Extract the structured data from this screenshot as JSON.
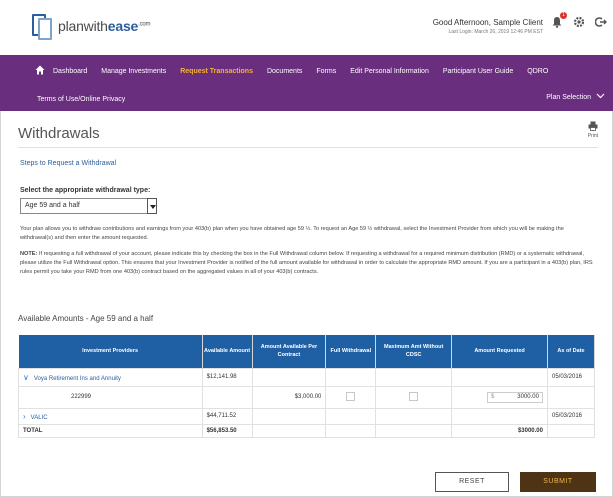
{
  "header": {
    "logo_prefix": "planwith",
    "logo_bold": "ease",
    "logo_suffix": ".com",
    "greeting": "Good Afternoon, Sample Client",
    "last_login": "Last Login: March 26, 2019 12:46 PM EST",
    "notifications_count": "1"
  },
  "nav": {
    "items": [
      "Dashboard",
      "Manage Investments",
      "Request Transactions",
      "Documents",
      "Forms",
      "Edit Personal Information",
      "Participant User Guide",
      "QDRO"
    ],
    "row2_item": "Terms of Use/Online Privacy",
    "plan_selection": "Plan Selection"
  },
  "page": {
    "title": "Withdrawals",
    "print_label": "Print",
    "steps_link": "Steps to Request a Withdrawal",
    "select_label": "Select the appropriate withdrawal type:",
    "select_value": "Age 59 and a half",
    "para1": "Your plan allows you to withdraw contributions and earnings from your 403(b) plan when you have obtained age 59 ½. To request an Age 59 ½ withdrawal, select the Investment Provider from which you will be making the withdrawal(s) and then enter the amount requested.",
    "para2_label": "NOTE:",
    "para2": " If requesting a full withdrawal of your account, please indicate this by checking the box in the Full Withdrawal column below. If requesting a withdrawal for a required minimum distribution (RMD) or a systematic withdrawal, please utilize the Full Withdrawal option. This ensures that your Investment Provider is notified of the full amount available for withdrawal in order to calculate the appropriate RMD amount. If you are a participant in a 403(b) plan, IRS rules permit you take your RMD from one 403(b) contract based on the aggregated values in all of your 403(b) contracts.",
    "section_title": "Available Amounts - Age 59 and a half"
  },
  "table": {
    "headers": [
      "Investment Providers",
      "Available Amount",
      "Amount Available Per Contract",
      "Full Withdrawal",
      "Maximum Amt Without CDSC",
      "Amount Requested",
      "As of Date"
    ],
    "rows": [
      {
        "provider": "Voya Retirement Ins and Annuity",
        "available": "$12,141.98",
        "date": "05/03/2016"
      },
      {
        "contract": "222999",
        "per_contract": "$3,000.00",
        "currency": "$",
        "requested": "3000.00"
      },
      {
        "provider": "VALIC",
        "available": "$44,711.52",
        "date": "05/03/2016"
      }
    ],
    "total_label": "TOTAL",
    "total_available": "$56,853.50",
    "total_requested": "$3000.00"
  },
  "buttons": {
    "reset": "RESET",
    "submit": "SUBMIT"
  },
  "colors": {
    "nav_bg": "#6a2e7f",
    "nav_active": "#f5b335",
    "table_header": "#1f5fa4",
    "submit_bg": "#4e3415",
    "submit_text": "#f0b548"
  }
}
